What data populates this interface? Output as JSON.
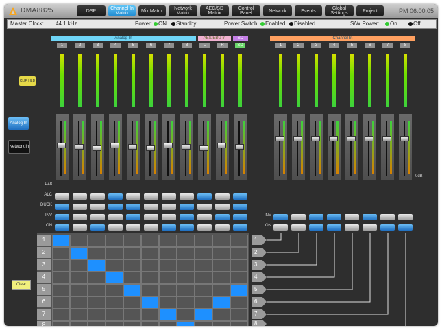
{
  "app": {
    "brand": "DMA8825",
    "clock": "PM 06:00:05"
  },
  "tabs": [
    {
      "label": "DSP",
      "active": false
    },
    {
      "label": "Channel In Matrix",
      "active": true
    },
    {
      "label": "Mix Matrix",
      "active": false
    },
    {
      "label": "Network Matrix",
      "active": false
    },
    {
      "label": "AEC/SD Matrix",
      "active": false
    },
    {
      "label": "Control Panel",
      "active": false
    },
    {
      "label": "Network",
      "active": false
    },
    {
      "label": "Events",
      "active": false
    },
    {
      "label": "Global Settings",
      "active": false
    },
    {
      "label": "Project",
      "active": false
    }
  ],
  "status": {
    "master_clock_label": "Master Clock:",
    "master_clock_value": "44.1 kHz",
    "power_label": "Power:",
    "power_on": "ON",
    "power_standby": "Standby",
    "power_switch_label": "Power Switch:",
    "enabled": "Enabled",
    "disabled": "Disabled",
    "sw_power_label": "S/W Power:",
    "sw_on": "On",
    "sw_off": "Off"
  },
  "groups": {
    "analog_in": "Analog In",
    "aes_in": "AES/EBU In",
    "sd": "SD",
    "channel_in": "Channel In"
  },
  "analog_channels": [
    "1",
    "2",
    "3",
    "4",
    "5",
    "6",
    "7",
    "8"
  ],
  "aes_channels": [
    "L",
    "R"
  ],
  "sd_channel": "SD",
  "channel_in_channels": [
    "1",
    "2",
    "3",
    "4",
    "5",
    "6",
    "7",
    "8"
  ],
  "side": {
    "clip_button": "CLIP HLD",
    "analog_button": "Analog In",
    "network_button": "Network In",
    "clear_button": "Clear"
  },
  "row_labels": {
    "phantom": "P48",
    "alc": "ALC",
    "duck": "DUCK",
    "inv": "INV",
    "on": "ON",
    "db": "0dB"
  },
  "matrix_rows": [
    "1",
    "2",
    "3",
    "4",
    "5",
    "6",
    "7",
    "8"
  ],
  "output_rows": [
    "1",
    "2",
    "3",
    "4",
    "5",
    "6",
    "7",
    "8"
  ],
  "colors": {
    "accent": "#1e90ff",
    "analog_header": "#6fd5f7",
    "aes_header": "#f0b0d0",
    "sd_header": "#c47fe6",
    "channel_header": "#ffa060"
  }
}
